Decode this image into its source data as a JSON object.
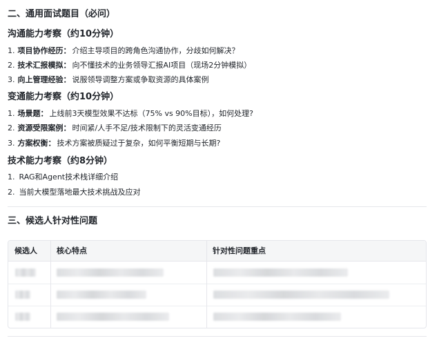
{
  "section2": {
    "title": "二、通用面试题目（必问）",
    "groups": [
      {
        "title": "沟通能力考察（约10分钟）",
        "items": [
          {
            "num": "1.",
            "label": "项目协作经历：",
            "desc": "介绍主导项目的跨角色沟通协作，分歧如何解决？"
          },
          {
            "num": "2.",
            "label": "技术汇报模拟：",
            "desc": "向不懂技术的业务领导汇报AI项目（现场2分钟模拟）"
          },
          {
            "num": "3.",
            "label": "向上管理经验：",
            "desc": "说服领导调整方案或争取资源的具体案例"
          }
        ]
      },
      {
        "title": "变通能力考察（约10分钟）",
        "items": [
          {
            "num": "1.",
            "label": "场景题：",
            "desc": "上线前3天模型效果不达标（75% vs 90%目标），如何处理?"
          },
          {
            "num": "2.",
            "label": "资源受限案例：",
            "desc": "时间紧/人手不足/技术限制下的灵活变通经历"
          },
          {
            "num": "3.",
            "label": "方案权衡：",
            "desc": "技术方案被质疑过于复杂，如何平衡短期与长期?"
          }
        ]
      },
      {
        "title": "技术能力考察（约8分钟）",
        "items": [
          {
            "num": "1.",
            "label": "",
            "desc": "RAG和Agent技术栈详细介绍"
          },
          {
            "num": "2.",
            "label": "",
            "desc": "当前大模型落地最大技术挑战及应对"
          }
        ]
      }
    ]
  },
  "section3": {
    "title": "三、候选人针对性问题",
    "table": {
      "headers": [
        "候选人",
        "核心特点",
        "针对性问题重点"
      ],
      "row_count": 3
    }
  }
}
